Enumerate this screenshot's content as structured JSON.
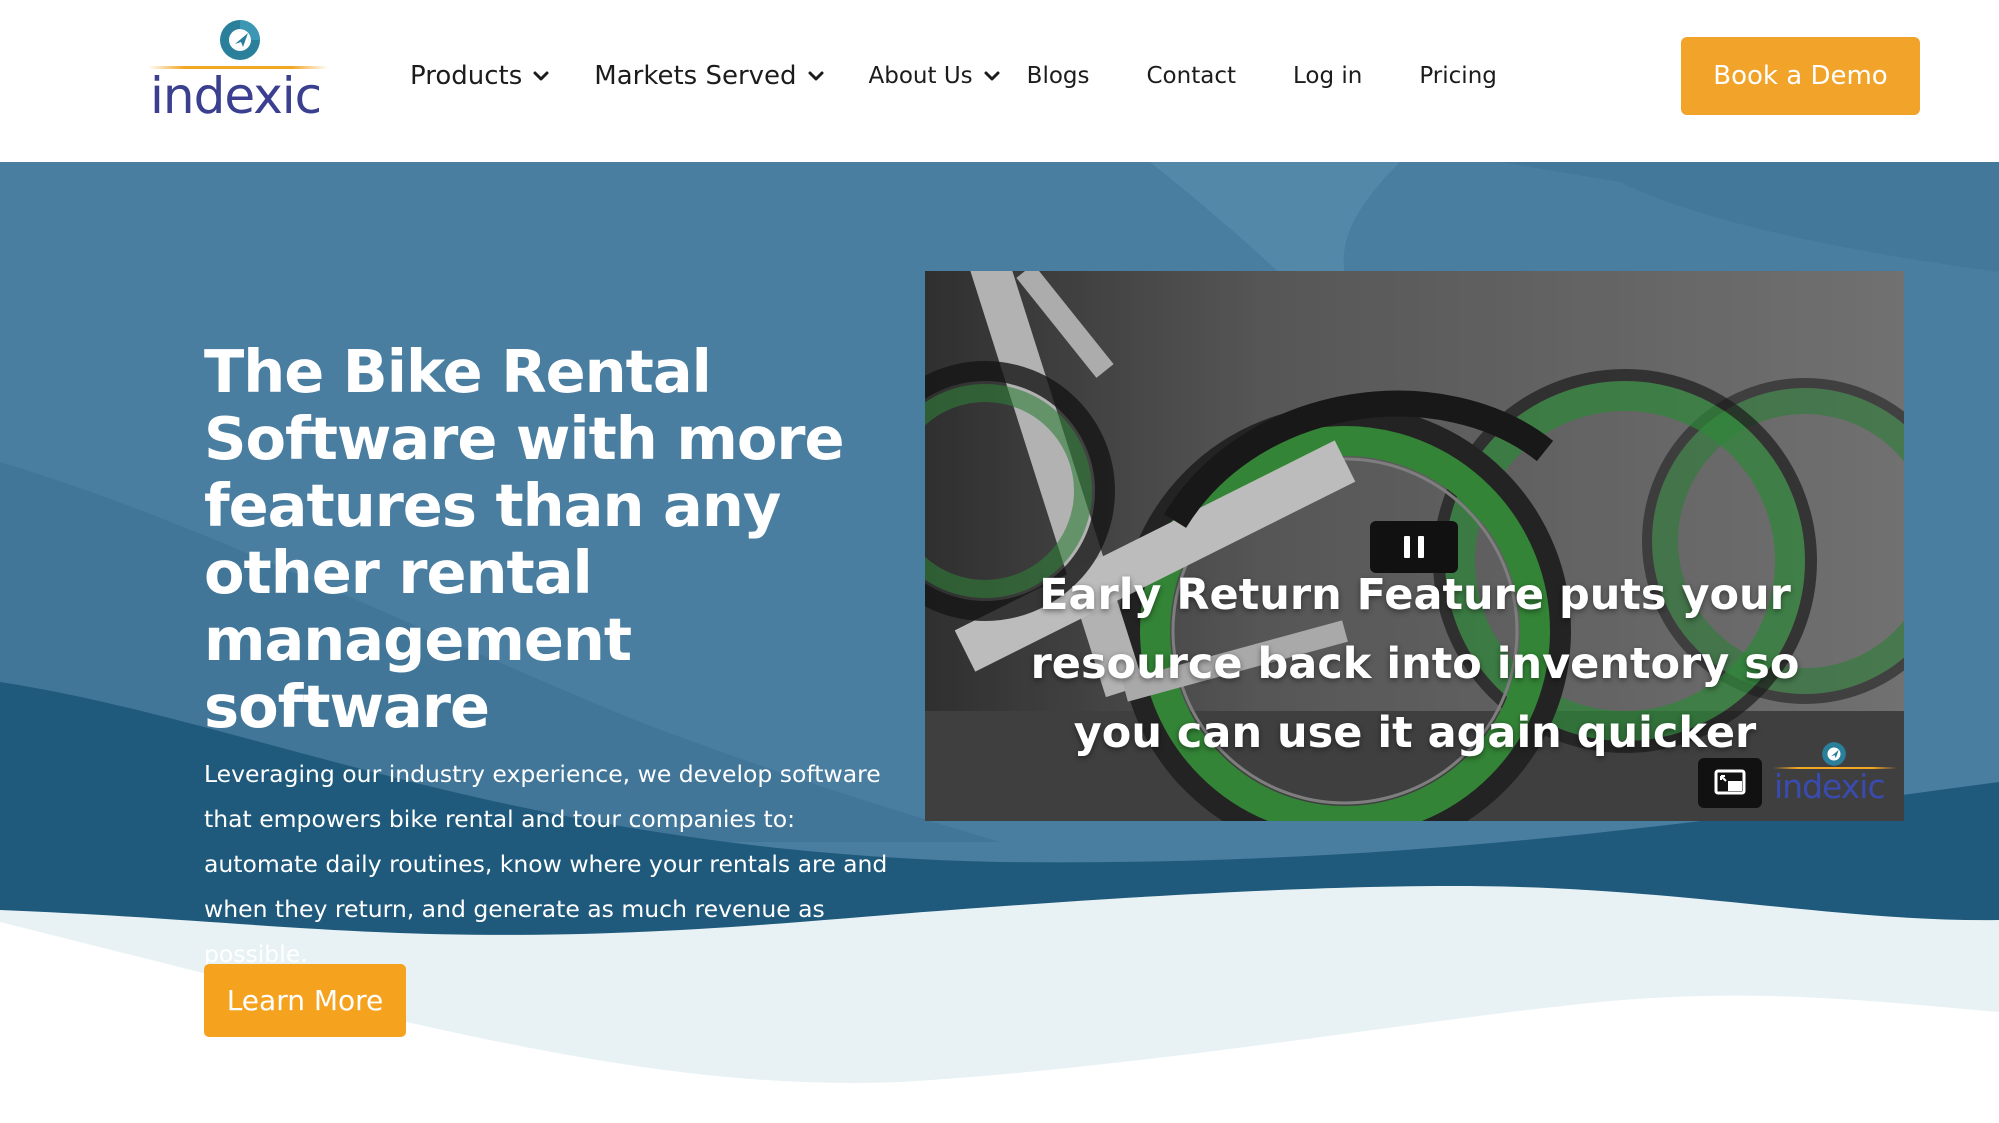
{
  "header": {
    "logo_text": "indexic",
    "nav": [
      {
        "label": "Products",
        "dropdown": true
      },
      {
        "label": "Markets Served",
        "dropdown": true
      },
      {
        "label": "About Us",
        "dropdown": true
      },
      {
        "label": "Blogs",
        "dropdown": false
      },
      {
        "label": "Contact",
        "dropdown": false
      },
      {
        "label": "Log in",
        "dropdown": false
      },
      {
        "label": "Pricing",
        "dropdown": false
      }
    ],
    "cta_label": "Book a Demo"
  },
  "hero": {
    "title": "The Bike Rental Software with more features than any other rental management software",
    "description": "Leveraging our industry experience, we develop software that empowers bike rental and tour companies to: automate daily routines, know where your rentals are and when they return, and generate as much revenue as possible.",
    "cta_label": "Learn More"
  },
  "video": {
    "caption": "Early Return Feature puts your resource back into inventory so you can use it again quicker",
    "watermark_text": "indexic",
    "state": "playing",
    "icons": {
      "pause": "pause-icon",
      "pip": "picture-in-picture-icon"
    }
  },
  "colors": {
    "brand_navy": "#3a3f8f",
    "brand_teal": "#2a7f9b",
    "accent_orange": "#f2a32a",
    "hero_blue": "#4a7ea1",
    "hero_dark_blue": "#1f5a7c",
    "wheel_green": "#3fa243"
  }
}
